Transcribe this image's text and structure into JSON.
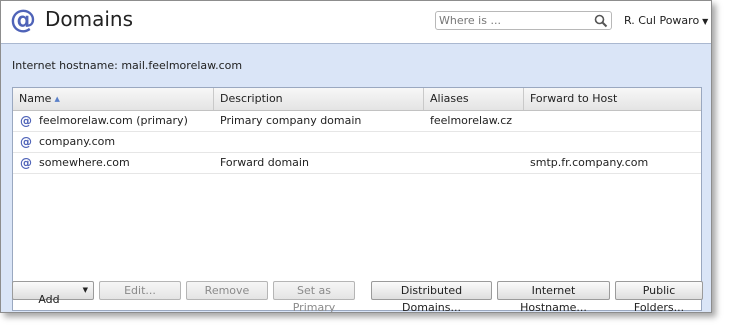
{
  "header": {
    "title": "Domains",
    "search_placeholder": "Where is ...",
    "user_name": "R. Cul Powaro"
  },
  "hostname_text": "Internet hostname: mail.feelmorelaw.com",
  "table": {
    "columns": [
      "Name",
      "Description",
      "Aliases",
      "Forward to Host"
    ],
    "rows": [
      {
        "name": "feelmorelaw.com (primary)",
        "description": "Primary company domain",
        "aliases": "feelmorelaw.cz",
        "forward": ""
      },
      {
        "name": "company.com",
        "description": "",
        "aliases": "",
        "forward": ""
      },
      {
        "name": "somewhere.com",
        "description": "Forward domain",
        "aliases": "",
        "forward": "smtp.fr.company.com"
      }
    ]
  },
  "buttons": {
    "add": "Add",
    "edit": "Edit...",
    "remove": "Remove",
    "set_primary": "Set as Primary",
    "distributed": "Distributed Domains...",
    "internet_hostname": "Internet Hostname...",
    "public_folders": "Public Folders..."
  },
  "colors": {
    "accent": "#4f63b8",
    "panel_bg": "#dae5f7"
  },
  "icons": {
    "app": "at-sign-icon",
    "search": "search-icon",
    "row": "at-sign-icon"
  }
}
